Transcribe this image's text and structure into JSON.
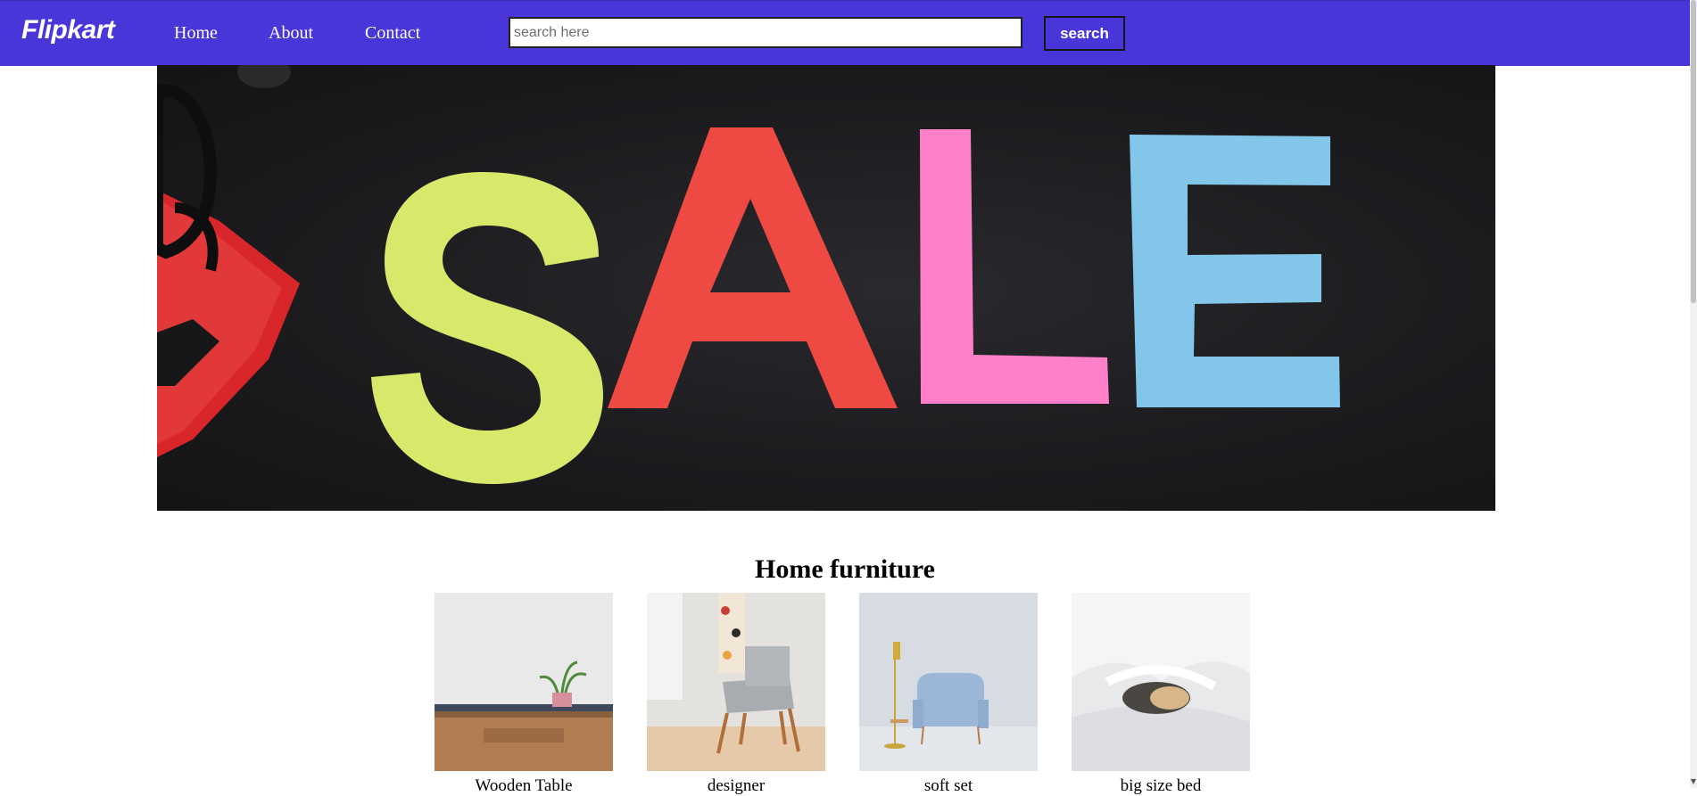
{
  "navbar": {
    "brand": "Flipkart",
    "links": [
      "Home",
      "About",
      "Contact"
    ],
    "search_placeholder": "search here",
    "search_value": "",
    "search_button": "search"
  },
  "banner": {
    "letters": [
      {
        "char": "S",
        "color": "#d8e86a"
      },
      {
        "char": "A",
        "color": "#ef4944"
      },
      {
        "char": "L",
        "color": "#ff7fc8"
      },
      {
        "char": "E",
        "color": "#82c6ea"
      }
    ]
  },
  "section": {
    "title": "Home furniture",
    "products": [
      {
        "name": "Wooden Table"
      },
      {
        "name": "designer"
      },
      {
        "name": "soft set"
      },
      {
        "name": "big size bed"
      }
    ]
  },
  "colors": {
    "navbar_bg": "#4836d9",
    "page_bg": "#ffffff"
  }
}
